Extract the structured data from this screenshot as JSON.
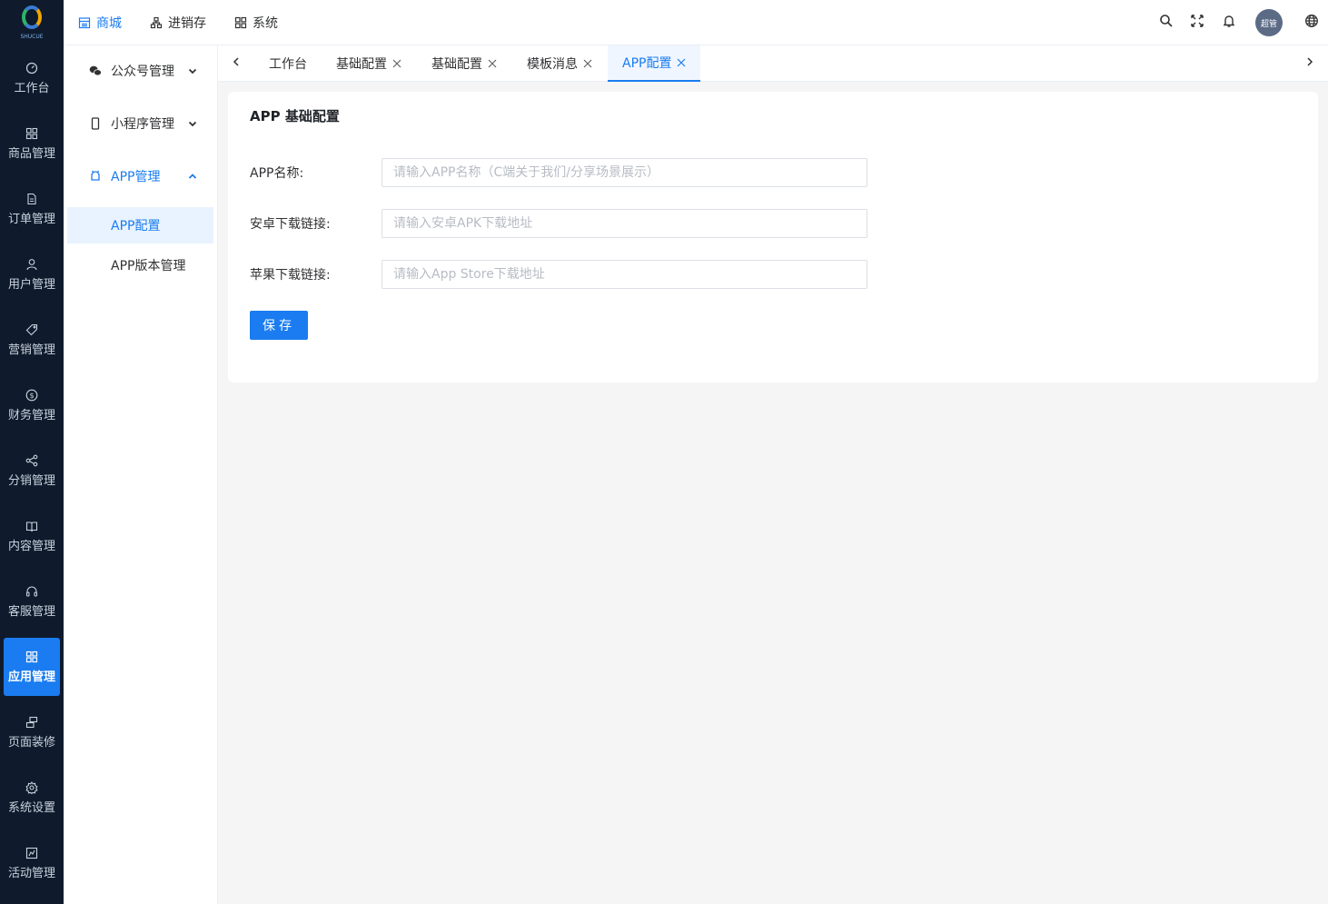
{
  "brand": {
    "logo_text": "SHUCUE",
    "accent": "#1a7cf0",
    "nav_bg": "#0f1b2d"
  },
  "leftnav": {
    "items": [
      {
        "label": "工作台",
        "icon": "dashboard-icon"
      },
      {
        "label": "商品管理",
        "icon": "grid-icon"
      },
      {
        "label": "订单管理",
        "icon": "document-icon"
      },
      {
        "label": "用户管理",
        "icon": "user-icon"
      },
      {
        "label": "营销管理",
        "icon": "tag-icon"
      },
      {
        "label": "财务管理",
        "icon": "dollar-icon"
      },
      {
        "label": "分销管理",
        "icon": "share-icon"
      },
      {
        "label": "内容管理",
        "icon": "book-icon"
      },
      {
        "label": "客服管理",
        "icon": "headset-icon"
      },
      {
        "label": "应用管理",
        "icon": "apps-icon",
        "active": true
      },
      {
        "label": "页面装修",
        "icon": "layout-icon"
      },
      {
        "label": "系统设置",
        "icon": "gear-icon"
      },
      {
        "label": "活动管理",
        "icon": "activity-icon"
      }
    ]
  },
  "topbar": {
    "menus": [
      {
        "label": "商城",
        "icon": "store-icon",
        "active": true
      },
      {
        "label": "进销存",
        "icon": "hierarchy-icon"
      },
      {
        "label": "系统",
        "icon": "system-icon"
      }
    ],
    "avatar_text": "超管"
  },
  "subside": {
    "groups": [
      {
        "label": "公众号管理",
        "icon": "wechat-icon"
      },
      {
        "label": "小程序管理",
        "icon": "phone-icon"
      },
      {
        "label": "APP管理",
        "icon": "android-icon",
        "open": true
      }
    ],
    "items": [
      {
        "label": "APP配置",
        "active": true
      },
      {
        "label": "APP版本管理"
      }
    ]
  },
  "tabs": [
    {
      "label": "工作台",
      "closable": false
    },
    {
      "label": "基础配置",
      "closable": true
    },
    {
      "label": "基础配置",
      "closable": true
    },
    {
      "label": "模板消息",
      "closable": true
    },
    {
      "label": "APP配置",
      "closable": true,
      "active": true
    }
  ],
  "form": {
    "title": "APP 基础配置",
    "fields": [
      {
        "label": "APP名称:",
        "value": "",
        "placeholder": "请输入APP名称（C端关于我们/分享场景展示）"
      },
      {
        "label": "安卓下载链接:",
        "value": "",
        "placeholder": "请输入安卓APK下载地址"
      },
      {
        "label": "苹果下载链接:",
        "value": "",
        "placeholder": "请输入App Store下载地址"
      }
    ],
    "save_label": "保存"
  }
}
